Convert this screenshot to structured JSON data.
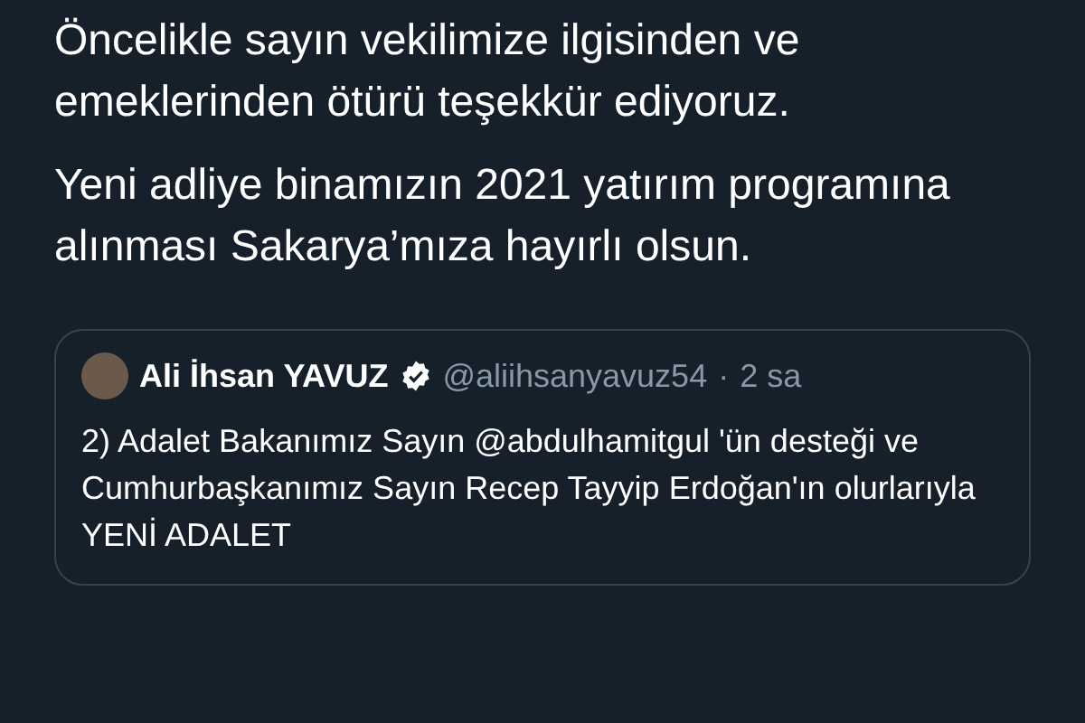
{
  "tweet": {
    "paragraphs": [
      "Öncelikle sayın vekilimize ilgisinden ve emeklerinden ötürü teşekkür ediyoruz.",
      "Yeni adliye binamızın 2021 yatırım programına alınması Sakarya’mıza hayırlı olsun."
    ]
  },
  "quoted_tweet": {
    "name": "Ali İhsan YAVUZ",
    "verified": true,
    "handle": "@aliihsanyavuz54",
    "separator": "·",
    "time": "2 sa",
    "text": "2) Adalet Bakanımız Sayın @abdulhamitgul 'ün desteği ve Cumhurbaşkanımız Sayın Recep Tayyip Erdoğan'ın olurlarıyla YENİ ADALET"
  }
}
